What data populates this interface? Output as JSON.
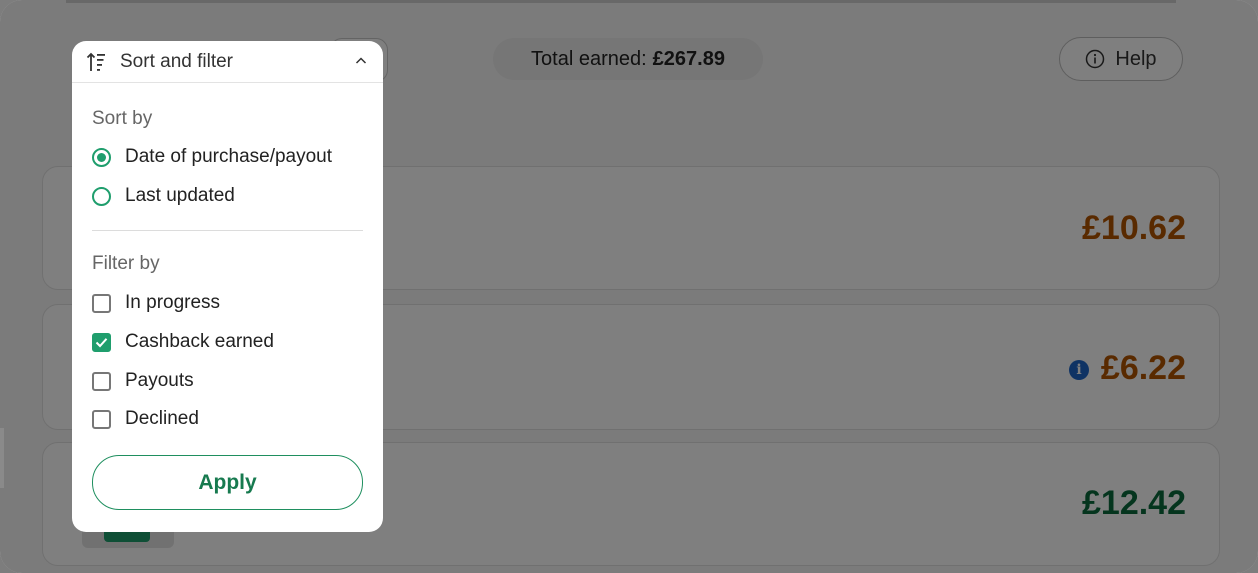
{
  "header": {
    "total_label": "Total earned:",
    "total_value": "£267.89",
    "help_label": "Help"
  },
  "transactions": [
    {
      "amount": "£10.62",
      "color": "#b35400"
    },
    {
      "amount": "£6.22",
      "color": "#b35400",
      "info_icon": "info-icon"
    },
    {
      "amount": "£12.42",
      "color": "#0a6a3d"
    }
  ],
  "panel": {
    "title": "Sort and filter",
    "sort_label": "Sort by",
    "sort_options": [
      {
        "label": "Date of purchase/payout",
        "selected": true
      },
      {
        "label": "Last updated",
        "selected": false
      }
    ],
    "filter_label": "Filter by",
    "filter_options": [
      {
        "label": "In progress",
        "checked": false
      },
      {
        "label": "Cashback earned",
        "checked": true
      },
      {
        "label": "Payouts",
        "checked": false
      },
      {
        "label": "Declined",
        "checked": false
      }
    ],
    "apply_label": "Apply"
  },
  "colors": {
    "accent": "#1f9e6d",
    "pending_amount": "#b35400",
    "earned_amount": "#0a6a3d"
  }
}
